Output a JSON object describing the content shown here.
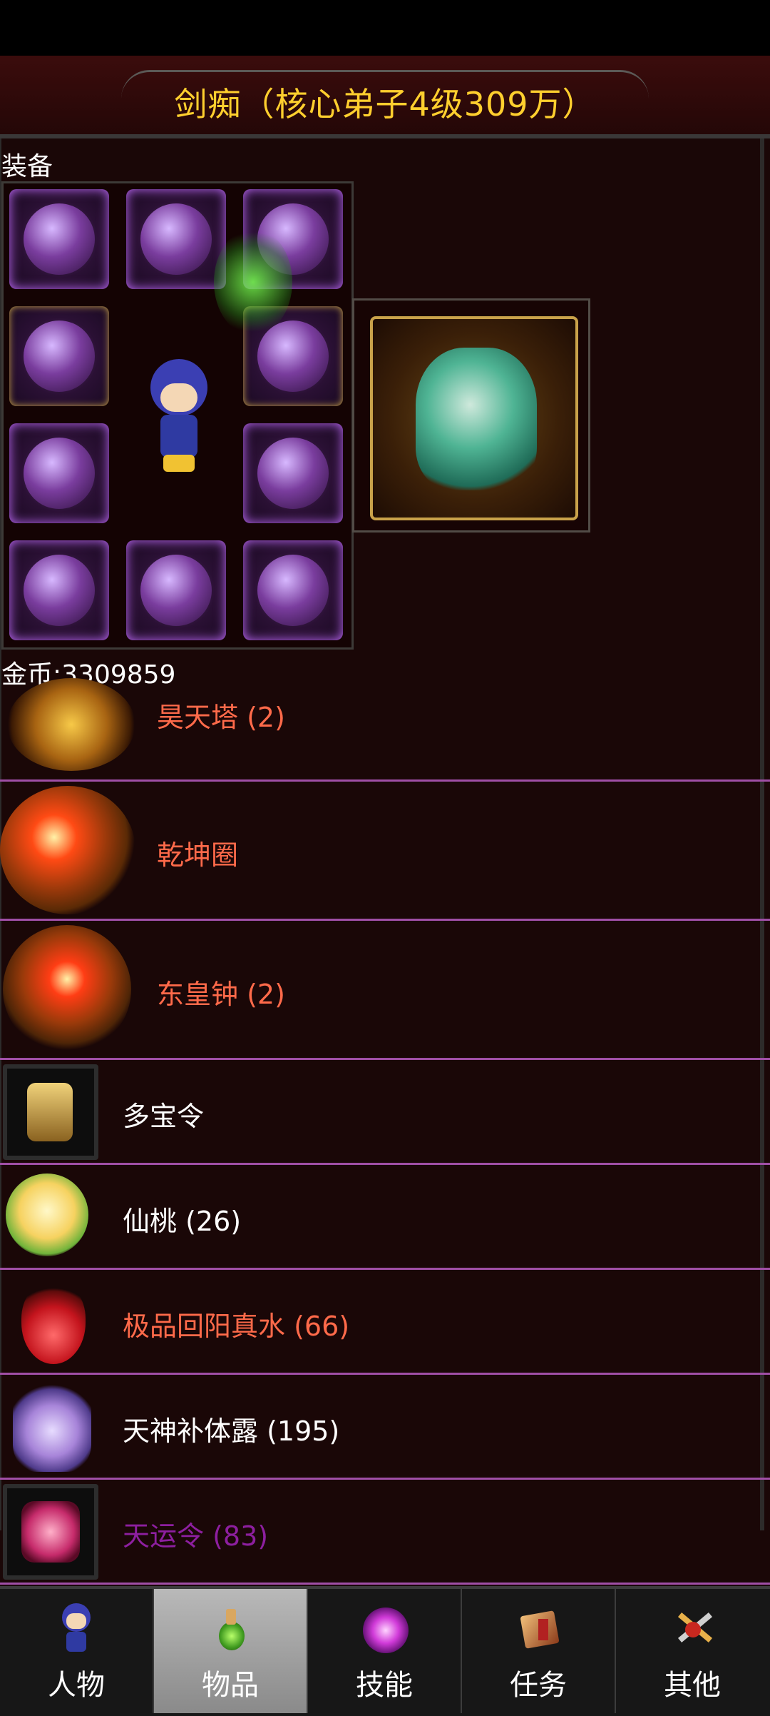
{
  "header": {
    "title": "剑痴（核心弟子4级309万）"
  },
  "equipment": {
    "label": "装备",
    "gold": "金币:3309859"
  },
  "items": [
    {
      "name": "昊天塔 (2)",
      "color": "#ff6a4a",
      "icon": "tower-icon"
    },
    {
      "name": "乾坤圈",
      "color": "#ff6a4a",
      "icon": "ring-icon"
    },
    {
      "name": "东皇钟 (2)",
      "color": "#ff6a4a",
      "icon": "bell-icon"
    },
    {
      "name": "多宝令",
      "color": "#ffffff",
      "icon": "token-icon"
    },
    {
      "name": "仙桃 (26)",
      "color": "#ffffff",
      "icon": "peach-icon"
    },
    {
      "name": "极品回阳真水 (66)",
      "color": "#ff6a4a",
      "icon": "potion-icon"
    },
    {
      "name": "天神补体露 (195)",
      "color": "#ffffff",
      "icon": "crystal-icon"
    },
    {
      "name": "天运令 (83)",
      "color": "#8d1f9f",
      "icon": "fortune-token-icon"
    }
  ],
  "tabs": [
    {
      "label": "人物",
      "icon": "character-icon"
    },
    {
      "label": "物品",
      "icon": "potion-bottle-icon",
      "active": true
    },
    {
      "label": "技能",
      "icon": "magic-orb-icon"
    },
    {
      "label": "任务",
      "icon": "quest-scroll-icon"
    },
    {
      "label": "其他",
      "icon": "crossed-swords-icon"
    }
  ]
}
